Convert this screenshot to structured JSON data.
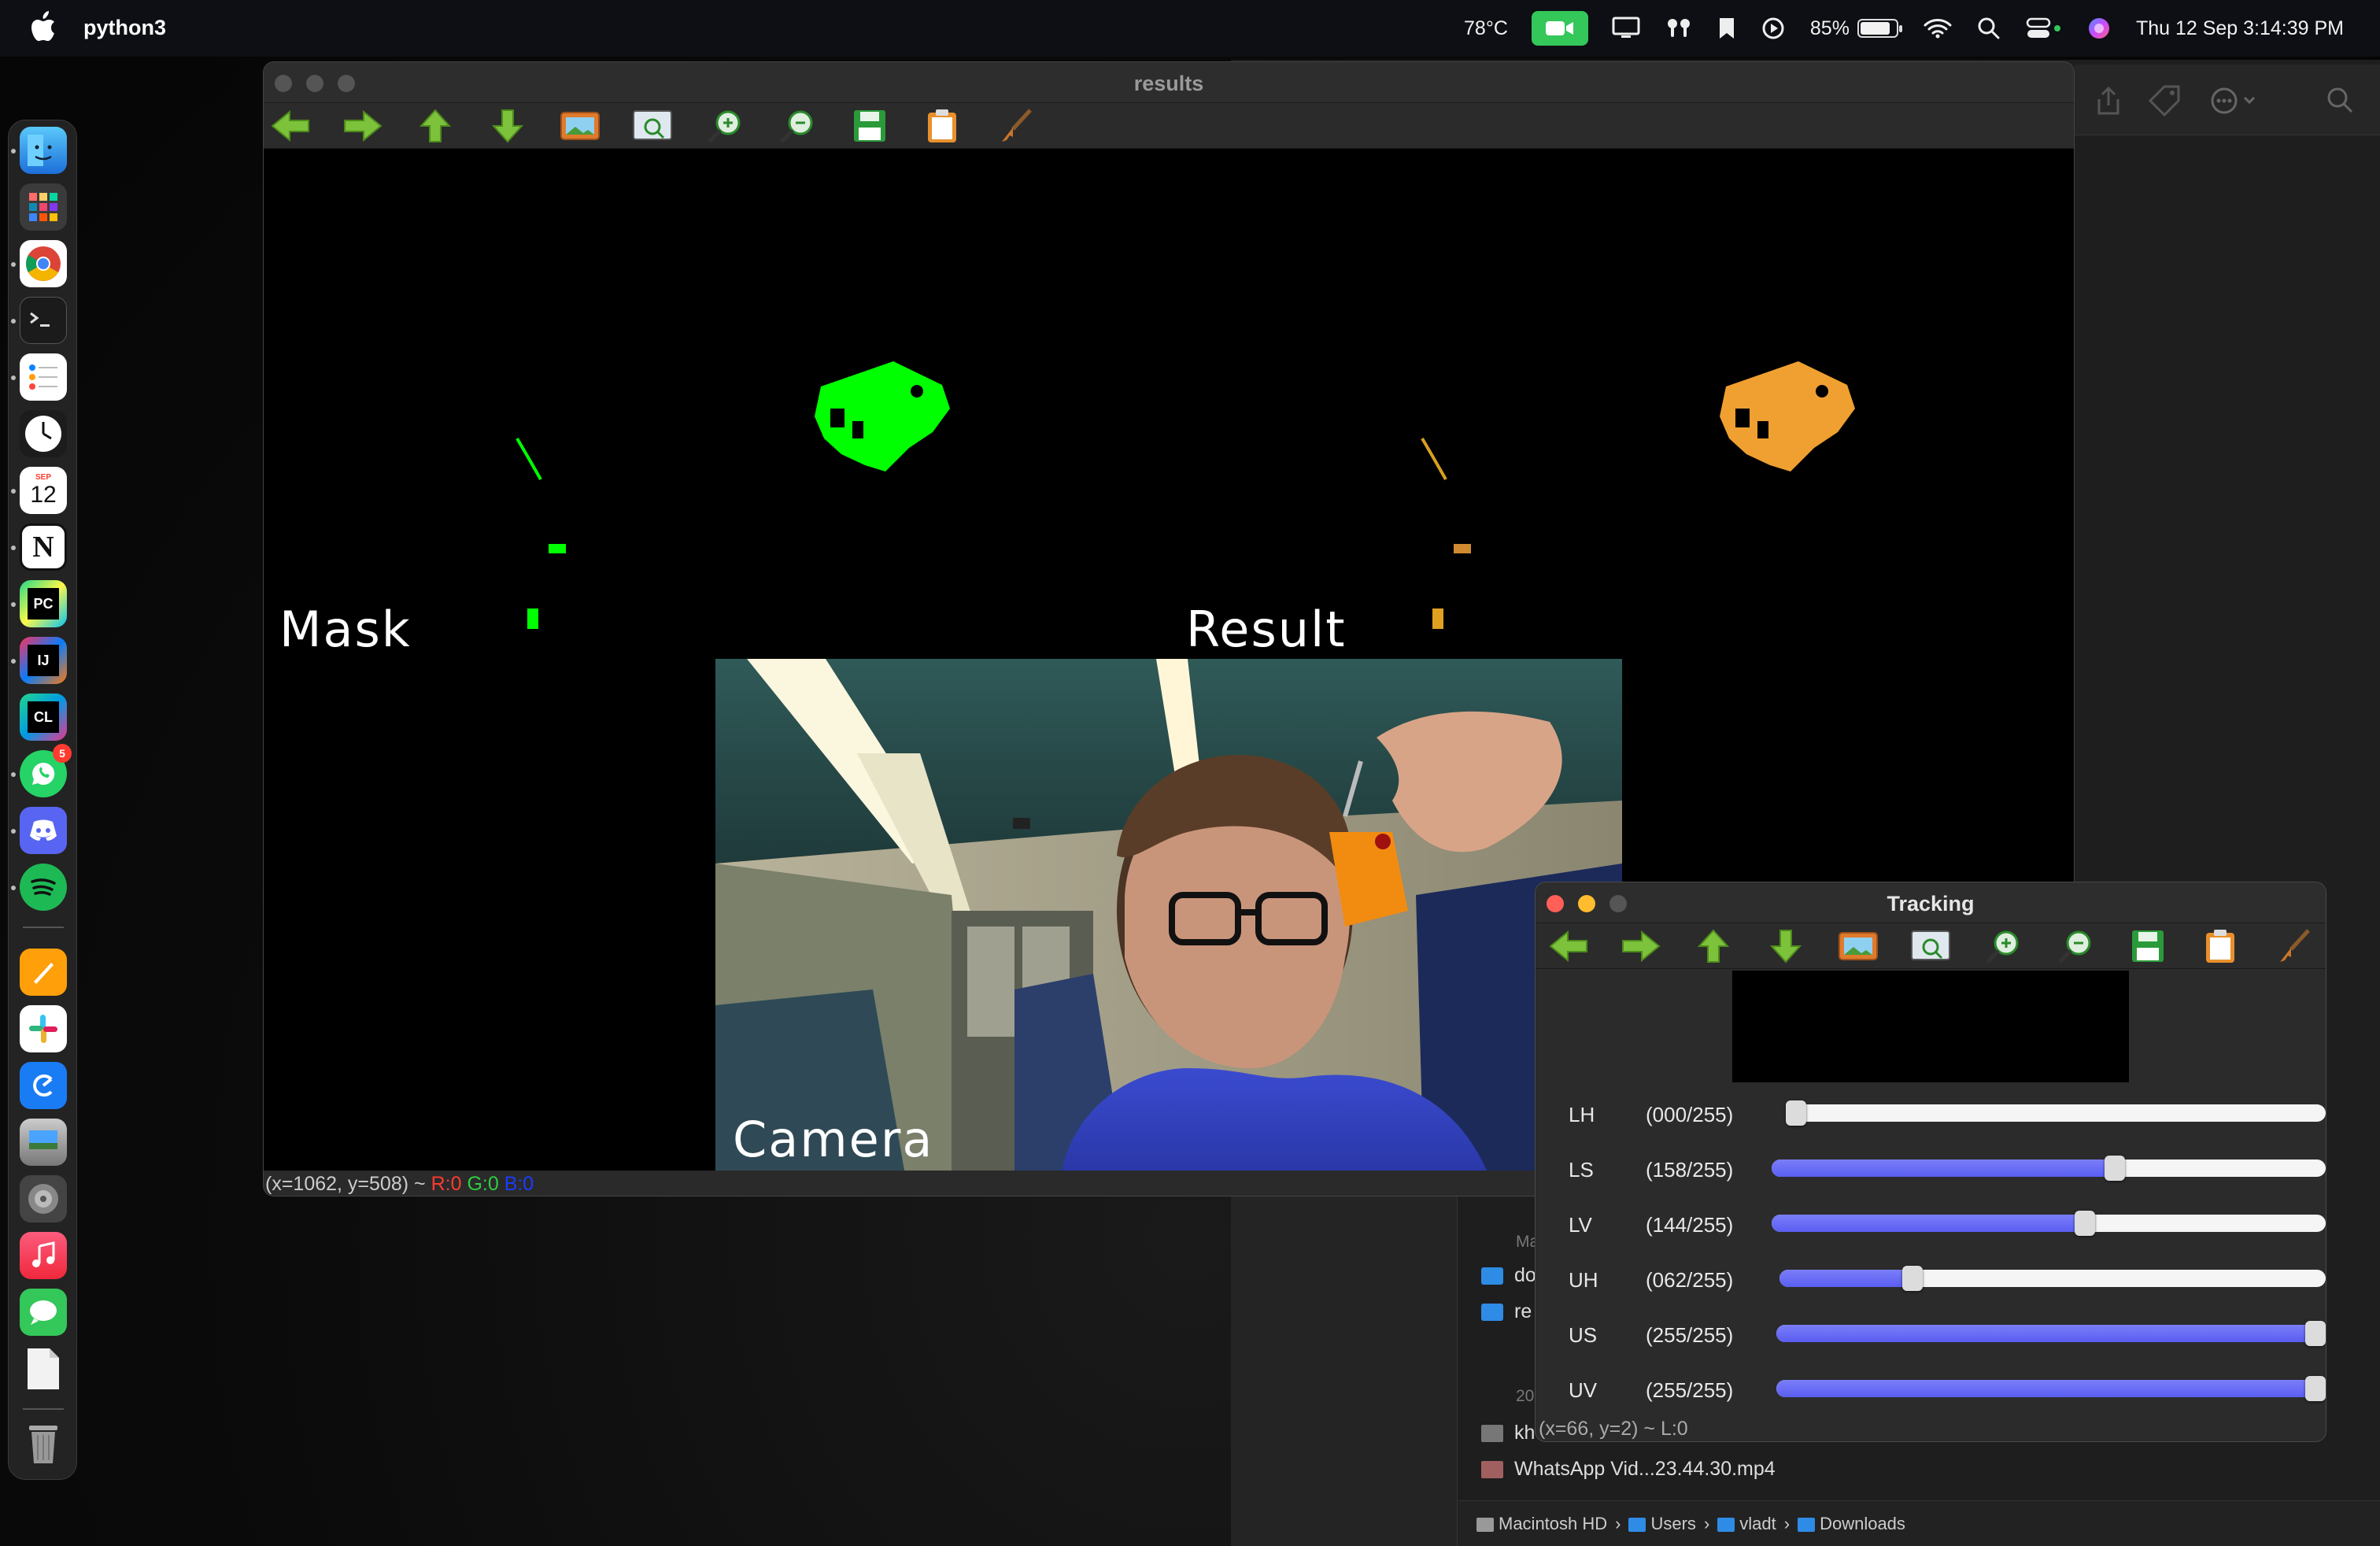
{
  "menubar": {
    "app_name": "python3",
    "temperature": "78°C",
    "battery": "85%",
    "battery_level": 0.85,
    "datetime": "Thu 12 Sep  3:14:39 PM",
    "camera_color": "#34c759"
  },
  "dock": {
    "calendar_month": "SEP",
    "calendar_day": "12",
    "notion_letter": "N",
    "pycharm_label": "PC",
    "intellij_label": "IJ",
    "clion_label": "CL",
    "whatsapp_badge": "5"
  },
  "results_window": {
    "title": "results",
    "status_coords": "(x=1062, y=508) ~",
    "status_r": "R:0",
    "status_g": "G:0",
    "status_b": "B:0",
    "labels": {
      "mask": "Mask",
      "result": "Result",
      "camera": "Camera"
    }
  },
  "tracking_window": {
    "title": "Tracking",
    "status": "(x=66, y=2) ~ L:0",
    "sliders": [
      {
        "name": "LH",
        "display": "(000/255)",
        "value": 0
      },
      {
        "name": "LS",
        "display": "(158/255)",
        "value": 158
      },
      {
        "name": "LV",
        "display": "(144/255)",
        "value": 144
      },
      {
        "name": "UH",
        "display": "(062/255)",
        "value": 62
      },
      {
        "name": "US",
        "display": "(255/255)",
        "value": 255
      },
      {
        "name": "UV",
        "display": "(255/255)",
        "value": 255
      }
    ],
    "slider_max": 255,
    "slider_color": "#5a5ef2"
  },
  "finder": {
    "section_a": "Ma",
    "section_b": "20",
    "rows": [
      {
        "name": "do"
      },
      {
        "name": "re"
      },
      {
        "name": "kh"
      },
      {
        "name": "WhatsApp Vid...23.44.30.mp4"
      }
    ],
    "path": [
      "Macintosh HD",
      "Users",
      "vladt",
      "Downloads"
    ]
  }
}
